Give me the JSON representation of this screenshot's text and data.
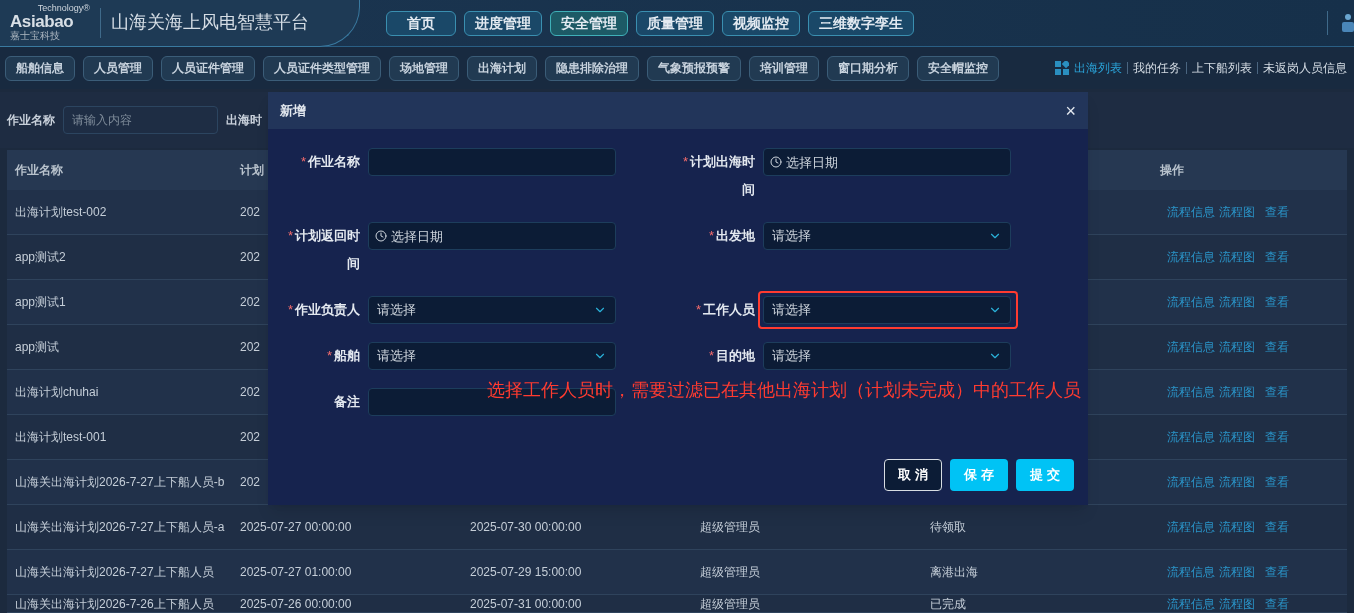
{
  "header": {
    "logo": {
      "brand": "Asiabao",
      "tagline": "Technology®",
      "subtitle": "嘉士宝科技"
    },
    "title": "山海关海上风电智慧平台",
    "nav": [
      {
        "label": "首页",
        "selected": false
      },
      {
        "label": "进度管理",
        "selected": false
      },
      {
        "label": "安全管理",
        "selected": true
      },
      {
        "label": "质量管理",
        "selected": false
      },
      {
        "label": "视频监控",
        "selected": false
      },
      {
        "label": "三维数字孪生",
        "selected": false
      }
    ]
  },
  "subnav": {
    "items": [
      "船舶信息",
      "人员管理",
      "人员证件管理",
      "人员证件类型管理",
      "场地管理",
      "出海计划",
      "隐患排除治理",
      "气象预报预警",
      "培训管理",
      "窗口期分析",
      "安全帽监控"
    ],
    "links": [
      {
        "label": "出海列表",
        "selected": true
      },
      {
        "label": "我的任务",
        "selected": false
      },
      {
        "label": "上下船列表",
        "selected": false
      },
      {
        "label": "未返岗人员信息",
        "selected": false
      }
    ]
  },
  "filter": {
    "name_label": "作业名称",
    "name_placeholder": "请输入内容",
    "time_label": "出海时"
  },
  "table": {
    "columns": [
      "作业名称",
      "计划",
      "操作"
    ],
    "rows": [
      {
        "cells": [
          "出海计划test-002",
          "202"
        ],
        "actions": [
          "流程信息",
          "流程图",
          "查看"
        ]
      },
      {
        "cells": [
          "app测试2",
          "202"
        ],
        "actions": [
          "流程信息",
          "流程图",
          "查看"
        ]
      },
      {
        "cells": [
          "app测试1",
          "202"
        ],
        "actions": [
          "流程信息",
          "流程图",
          "查看"
        ]
      },
      {
        "cells": [
          "app测试",
          "202"
        ],
        "actions": [
          "流程信息",
          "流程图",
          "查看"
        ]
      },
      {
        "cells": [
          "出海计划chuhai",
          "202"
        ],
        "actions": [
          "流程信息",
          "流程图",
          "查看"
        ]
      },
      {
        "cells": [
          "出海计划test-001",
          "202"
        ],
        "actions": [
          "流程信息",
          "流程图",
          "查看"
        ]
      },
      {
        "cells": [
          "山海关出海计划2026-7-27上下船人员-b",
          "202"
        ],
        "actions": [
          "流程信息",
          "流程图",
          "查看"
        ]
      },
      {
        "cells": [
          "山海关出海计划2026-7-27上下船人员-a",
          "2025-07-27 00:00:00",
          "2025-07-30 00:00:00",
          "超级管理员",
          "待领取"
        ],
        "actions": [
          "流程信息",
          "流程图",
          "查看"
        ]
      },
      {
        "cells": [
          "山海关出海计划2026-7-27上下船人员",
          "2025-07-27 01:00:00",
          "2025-07-29 15:00:00",
          "超级管理员",
          "离港出海"
        ],
        "actions": [
          "流程信息",
          "流程图",
          "查看"
        ]
      },
      {
        "cells": [
          "山海关出海计划2026-7-26上下船人员",
          "2025-07-26 00:00:00",
          "2025-07-31 00:00:00",
          "超级管理员",
          "已完成"
        ],
        "actions": [
          "流程信息",
          "流程图",
          "查看"
        ]
      }
    ]
  },
  "dialog": {
    "title": "新增",
    "close": "×",
    "fields": [
      {
        "kind": "text",
        "label": "作业名称",
        "required_mark": "*",
        "highlighted": false
      },
      {
        "kind": "date",
        "label": "计划出海时间",
        "required_mark": "*",
        "placeholder": "选择日期",
        "highlighted": false
      },
      {
        "kind": "date",
        "label": "计划返回时间",
        "required_mark": "*",
        "placeholder": "选择日期",
        "highlighted": false
      },
      {
        "kind": "select",
        "label": "出发地",
        "required_mark": "*",
        "placeholder": "请选择",
        "highlighted": false
      },
      {
        "kind": "select",
        "label": "作业负责人",
        "required_mark": "*",
        "placeholder": "请选择",
        "highlighted": false
      },
      {
        "kind": "select",
        "label": "工作人员",
        "required_mark": "*",
        "placeholder": "请选择",
        "highlighted": true
      },
      {
        "kind": "select",
        "label": "船舶",
        "required_mark": "*",
        "placeholder": "请选择",
        "highlighted": false
      },
      {
        "kind": "select",
        "label": "目的地",
        "required_mark": "*",
        "placeholder": "请选择",
        "highlighted": false
      },
      {
        "kind": "text",
        "label": "备注",
        "highlighted": false
      }
    ],
    "buttons": [
      {
        "label": "取 消",
        "kind": "outline"
      },
      {
        "label": "保 存",
        "kind": "primary"
      },
      {
        "label": "提 交",
        "kind": "primary"
      }
    ]
  },
  "annotation": "选择工作人员时，需要过滤已在其他出海计划（计划未完成）中的工作人员"
}
